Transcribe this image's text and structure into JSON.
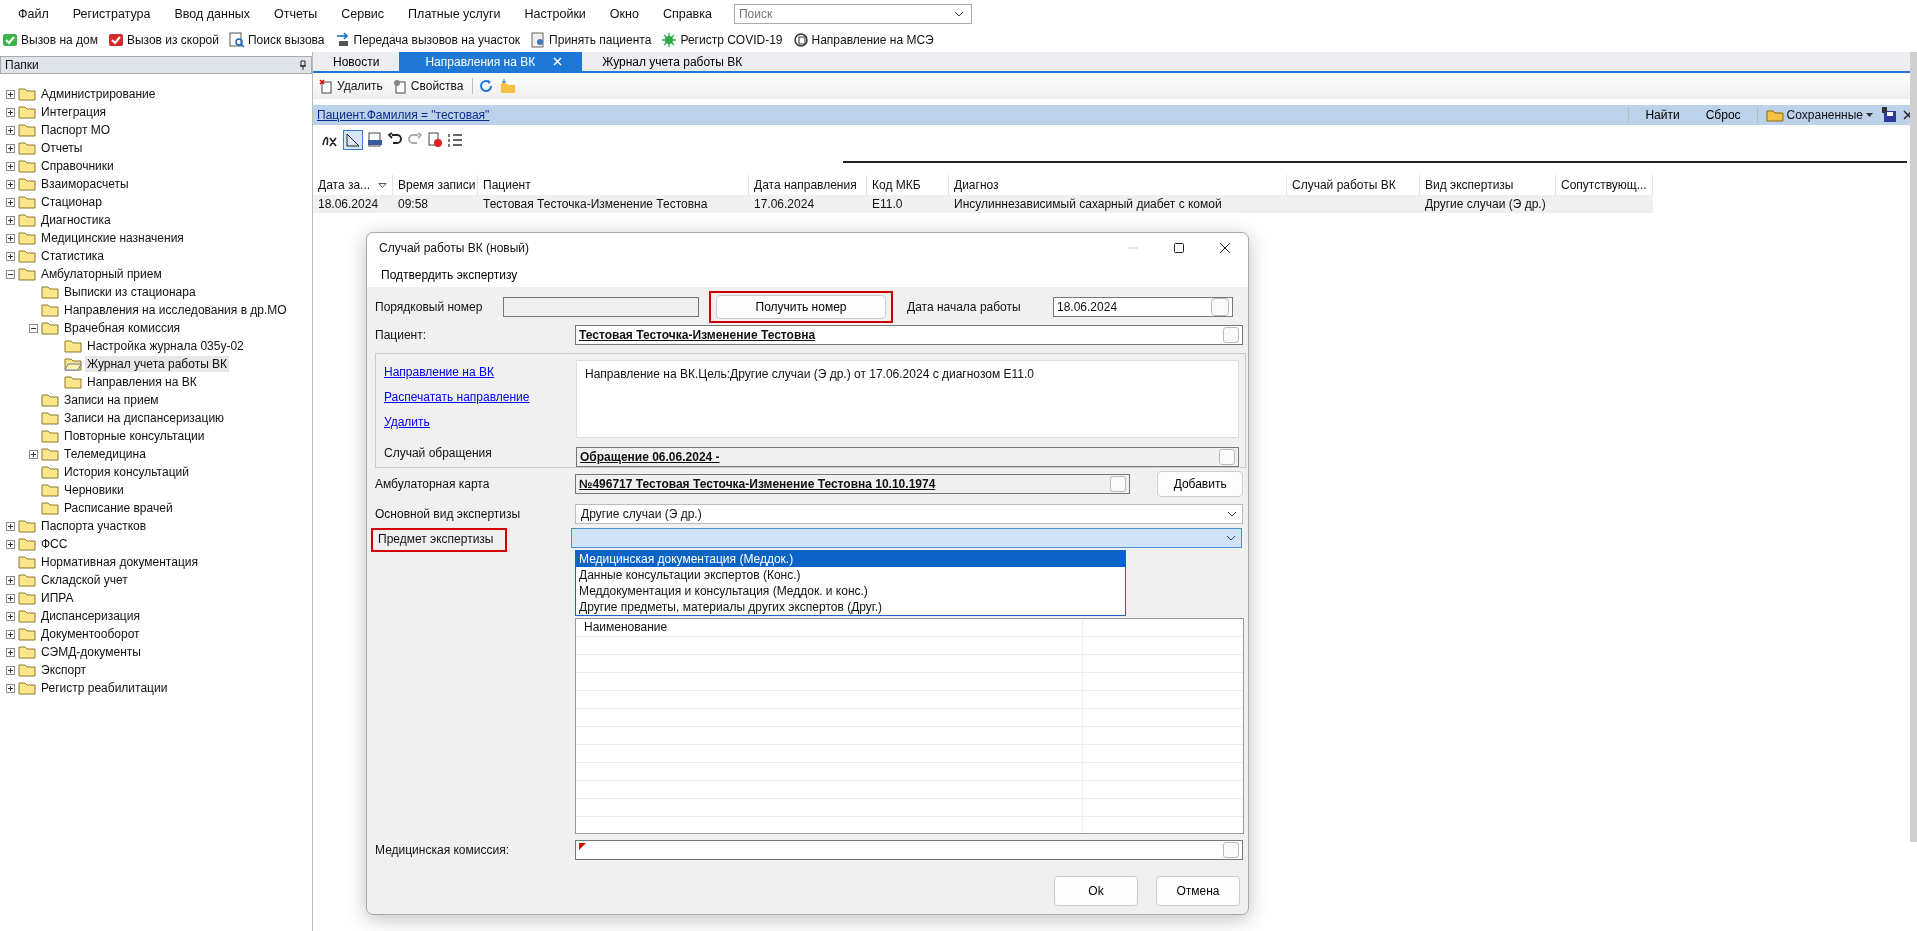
{
  "menu": {
    "items": [
      "Файл",
      "Регистратура",
      "Ввод данных",
      "Отчеты",
      "Сервис",
      "Платные услуги",
      "Настройки",
      "Окно",
      "Справка"
    ],
    "search": {
      "placeholder": "Поиск"
    }
  },
  "toolbar": [
    "Вызов на дом",
    "Вызов из скорой",
    "Поиск вызова",
    "Передача вызовов на участок",
    "Принять пациента",
    "Регистр COVID-19",
    "Направление на МСЭ"
  ],
  "folders": {
    "title": "Папки",
    "tree": [
      {
        "label": "Администрирование",
        "expanded": false,
        "selected": false
      },
      {
        "label": "Интеграция",
        "expanded": false,
        "selected": false
      },
      {
        "label": "Паспорт МО",
        "expanded": false,
        "selected": false
      },
      {
        "label": "Отчеты",
        "expanded": false,
        "selected": false
      },
      {
        "label": "Справочники",
        "expanded": false,
        "selected": false
      },
      {
        "label": "Взаиморасчеты",
        "expanded": false,
        "selected": false
      },
      {
        "label": "Стационар",
        "expanded": false,
        "selected": false
      },
      {
        "label": "Диагностика",
        "expanded": false,
        "selected": false
      },
      {
        "label": "Медицинские назначения",
        "expanded": false,
        "selected": false
      },
      {
        "label": "Статистика",
        "expanded": false,
        "selected": false
      },
      {
        "label": "Амбулаторный прием",
        "expanded": true,
        "selected": false,
        "children": [
          {
            "label": "Выписки из стационара",
            "selected": false
          },
          {
            "label": "Направления на исследования в др.МО",
            "selected": false
          },
          {
            "label": "Врачебная комиссия",
            "expanded": true,
            "selected": false,
            "children": [
              {
                "label": "Настройка журнала 035у-02",
                "selected": false
              },
              {
                "label": "Журнал учета работы ВК",
                "selected": true
              },
              {
                "label": "Направления на ВК",
                "selected": false
              }
            ]
          },
          {
            "label": "Записи на прием",
            "selected": false
          },
          {
            "label": "Записи на диспансеризацию",
            "selected": false
          },
          {
            "label": "Повторные консультации",
            "selected": false
          },
          {
            "label": "Телемедицина",
            "expanded": false,
            "selected": false
          },
          {
            "label": "История консультаций",
            "selected": false
          },
          {
            "label": "Черновики",
            "selected": false
          },
          {
            "label": "Расписание врачей",
            "selected": false
          }
        ]
      },
      {
        "label": "Паспорта участков",
        "expanded": false,
        "selected": false
      },
      {
        "label": "ФСС",
        "expanded": false,
        "selected": false
      },
      {
        "label": "Нормативная документация",
        "selected": false
      },
      {
        "label": "Складской учет",
        "expanded": false,
        "selected": false
      },
      {
        "label": "ИПРА",
        "expanded": false,
        "selected": false
      },
      {
        "label": "Диспансеризация",
        "expanded": false,
        "selected": false
      },
      {
        "label": "Документооборот",
        "expanded": false,
        "selected": false
      },
      {
        "label": "СЭМД-документы",
        "expanded": false,
        "selected": false
      },
      {
        "label": "Экспорт",
        "expanded": false,
        "selected": false
      },
      {
        "label": "Регистр реабилитации",
        "expanded": false,
        "selected": false
      }
    ]
  },
  "tabs": [
    {
      "label": "Новости",
      "selected": false
    },
    {
      "label": "Направления на ВК",
      "selected": true
    },
    {
      "label": "Журнал учета работы ВК",
      "selected": false
    }
  ],
  "doc_toolbar": [
    "Удалить",
    "Свойства"
  ],
  "filter": {
    "text": "Пациент.Фамилия = \"тестовая\"",
    "buttons": [
      "Найти",
      "Сброс"
    ],
    "saved": "Сохраненные"
  },
  "table": {
    "columns": [
      "Дата за...",
      "Время записи",
      "Пациент",
      "Дата направления",
      "Код МКБ",
      "Диагноз",
      "Случай работы ВК",
      "Вид экспертизы",
      "Сопутствующ..."
    ],
    "rows": [
      [
        "18.06.2024",
        "09:58",
        "Тестовая Тесточка-Изменение Тестовна",
        "17.06.2024",
        "E11.0",
        "Инсулиннезависимый сахарный диабет с комой",
        null,
        "Другие случаи (Э др.)",
        null
      ]
    ]
  },
  "dialog": {
    "title": "Случай работы ВК (новый)",
    "action": "Подтвердить экспертизу",
    "ordinal": {
      "label": "Порядковый номер",
      "button": "Получить номер",
      "highlighted": true
    },
    "start_date": {
      "label": "Дата начала работы",
      "value": "18.06.2024"
    },
    "patient": {
      "label": "Пациент:",
      "value": "Тестовая Тесточка-Изменение Тестовна"
    },
    "referral": {
      "links": [
        "Направление на ВК",
        "Распечатать направление",
        "Удалить"
      ],
      "text": "Направление на ВК.Цель:Другие случаи (Э др.) от 17.06.2024 с диагнозом E11.0",
      "case_label": "Случай обращения",
      "case_value": "Обращение 06.06.2024 -"
    },
    "card": {
      "label": "Амбулаторная карта",
      "value": "№496717 Тестовая Тесточка-Изменение Тестовна 10.10.1974",
      "button": "Добавить"
    },
    "expertise_type": {
      "label": "Основной вид экспертизы",
      "value": "Другие случаи (Э др.)"
    },
    "subject": {
      "label": "Предмет экспертизы",
      "highlighted": true,
      "options": [
        {
          "label": "Медицинская документация (Меддок.)",
          "selected": true
        },
        {
          "label": "Данные консультации экспертов (Конс.)",
          "selected": false
        },
        {
          "label": "Меддокументация и консультация (Меддок. и конс.)",
          "selected": false
        },
        {
          "label": "Другие предметы, материалы других экспертов (Друг.)",
          "selected": false
        }
      ]
    },
    "grid": {
      "columns": [
        "Наименование"
      ]
    },
    "commission": {
      "label": "Медицинская комиссия:",
      "required": true
    },
    "buttons": [
      "Ok",
      "Отмена"
    ]
  }
}
